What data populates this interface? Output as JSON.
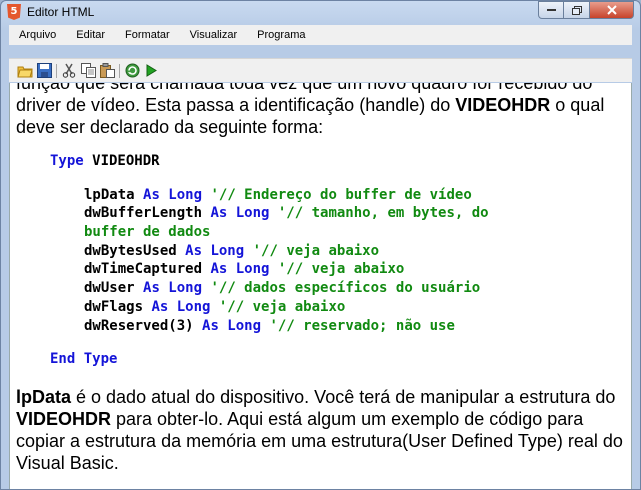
{
  "window": {
    "title": "Editor HTML",
    "icon": "html5-icon"
  },
  "menu": [
    "Arquivo",
    "Editar",
    "Formatar",
    "Visualizar",
    "Programa"
  ],
  "toolbar": [
    "open-folder-icon",
    "save-icon",
    "cut-icon",
    "copy-icon",
    "paste-icon",
    "refresh-icon",
    "run-icon"
  ],
  "doc": {
    "intro_p1": "função que será chamada toda vez que um novo quadro for recebido do driver de vídeo. Esta passa a identificação (handle) do ",
    "intro_bold": "VIDEOHDR",
    "intro_p2": " o qual deve ser declarado da seguinte forma:",
    "type_kw": "Type",
    "type_name": " VIDEOHDR",
    "fields": [
      {
        "name": "lpData ",
        "kw": "As Long",
        "comment": " '// Endereço do buffer de vídeo"
      },
      {
        "name": "dwBufferLength ",
        "kw": "As Long",
        "comment": " '// tamanho, em bytes, do"
      },
      {
        "name": "",
        "kw": "",
        "comment": "buffer de dados"
      },
      {
        "name": "dwBytesUsed ",
        "kw": "As Long",
        "comment": " '// veja abaixo"
      },
      {
        "name": "dwTimeCaptured ",
        "kw": "As Long",
        "comment": " '// veja abaixo"
      },
      {
        "name": "dwUser ",
        "kw": "As Long",
        "comment": " '// dados específicos do usuário"
      },
      {
        "name": "dwFlags ",
        "kw": "As Long",
        "comment": " '// veja abaixo"
      },
      {
        "name": "dwReserved(3) ",
        "kw": "As Long",
        "comment": " '// reservado; não use"
      }
    ],
    "end_type": "End Type",
    "p2_bold1": "lpData",
    "p2_t1": " é o dado atual do dispositivo. Você terá de manipular a estrutura do ",
    "p2_bold2": "VIDEOHDR",
    "p2_t2": " para obter-lo. Aqui está algum um exemplo de código para copiar a estrutura da memória em uma estrutura(User Defined Type) real do Visual Basic."
  }
}
